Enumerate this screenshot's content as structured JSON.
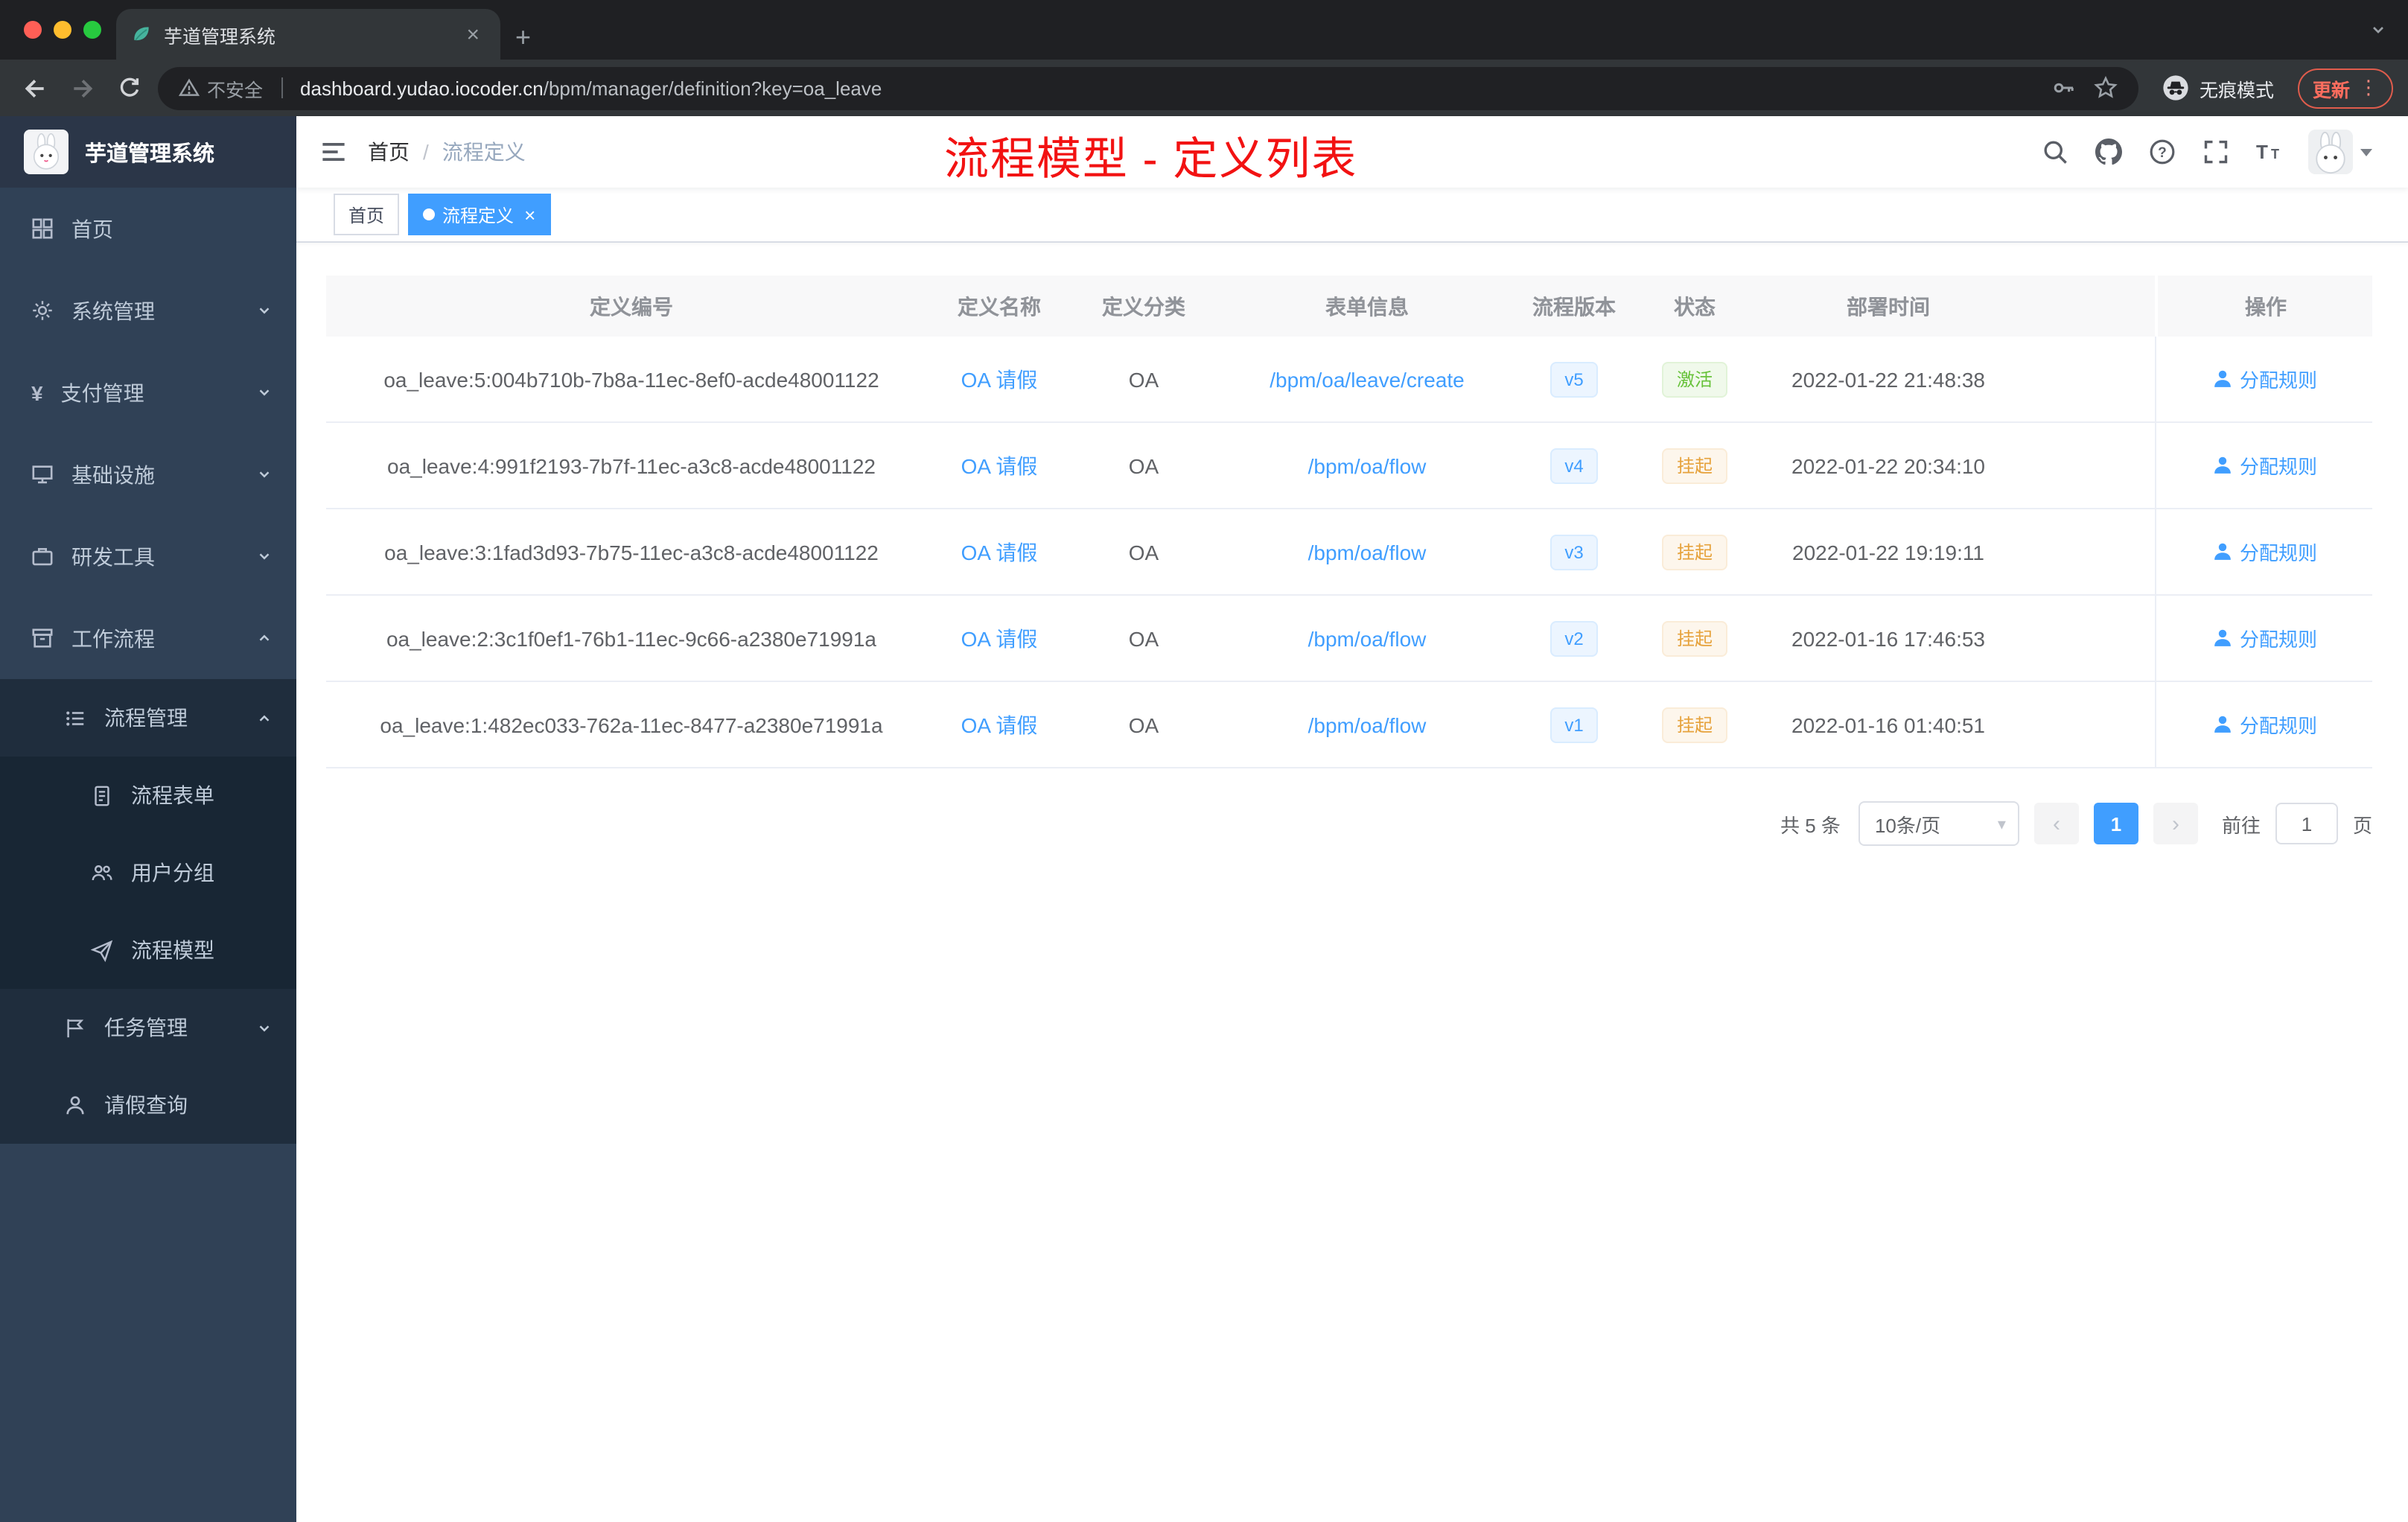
{
  "colors": {
    "accent": "#409eff",
    "annotation_red": "#f21212",
    "sidebar_bg": "#304156",
    "success": "#67c23a",
    "warning": "#e6a23c"
  },
  "icons": {
    "close": "×",
    "plus": "+",
    "more_vertical": "⋮",
    "prev": "‹",
    "next": "›",
    "select_caret": "▾",
    "help": "?"
  },
  "browser": {
    "tab_title": "芋道管理系统",
    "security_label": "不安全",
    "url_host": "dashboard.yudao.iocoder.cn",
    "url_path": "/bpm/manager/definition?key=oa_leave",
    "incognito_label": "无痕模式",
    "update_label": "更新"
  },
  "sidebar": {
    "logo_title": "芋道管理系统",
    "items": [
      {
        "label": "首页"
      },
      {
        "label": "系统管理"
      },
      {
        "label": "支付管理"
      },
      {
        "label": "基础设施"
      },
      {
        "label": "研发工具"
      },
      {
        "label": "工作流程"
      }
    ],
    "workflow": {
      "process_management": {
        "label": "流程管理"
      },
      "process_form": {
        "label": "流程表单"
      },
      "user_group": {
        "label": "用户分组"
      },
      "process_model": {
        "label": "流程模型"
      },
      "task_management": {
        "label": "任务管理"
      },
      "leave_query": {
        "label": "请假查询"
      }
    }
  },
  "header": {
    "breadcrumb_home": "首页",
    "breadcrumb_sep": "/",
    "breadcrumb_current": "流程定义",
    "annotation": "流程模型 - 定义列表"
  },
  "tags_view": {
    "tags": [
      {
        "label": "首页",
        "active": false
      },
      {
        "label": "流程定义",
        "active": true
      }
    ]
  },
  "table": {
    "columns": [
      "定义编号",
      "定义名称",
      "定义分类",
      "表单信息",
      "流程版本",
      "状态",
      "部署时间",
      "操作"
    ],
    "rows": [
      {
        "id": "oa_leave:5:004b710b-7b8a-11ec-8ef0-acde48001122",
        "name": "OA 请假",
        "category": "OA",
        "form": "/bpm/oa/leave/create",
        "version": "v5",
        "status": "激活",
        "status_type": "success",
        "time": "2022-01-22 21:48:38",
        "action": "分配规则"
      },
      {
        "id": "oa_leave:4:991f2193-7b7f-11ec-a3c8-acde48001122",
        "name": "OA 请假",
        "category": "OA",
        "form": "/bpm/oa/flow",
        "version": "v4",
        "status": "挂起",
        "status_type": "warning",
        "time": "2022-01-22 20:34:10",
        "action": "分配规则"
      },
      {
        "id": "oa_leave:3:1fad3d93-7b75-11ec-a3c8-acde48001122",
        "name": "OA 请假",
        "category": "OA",
        "form": "/bpm/oa/flow",
        "version": "v3",
        "status": "挂起",
        "status_type": "warning",
        "time": "2022-01-22 19:19:11",
        "action": "分配规则"
      },
      {
        "id": "oa_leave:2:3c1f0ef1-76b1-11ec-9c66-a2380e71991a",
        "name": "OA 请假",
        "category": "OA",
        "form": "/bpm/oa/flow",
        "version": "v2",
        "status": "挂起",
        "status_type": "warning",
        "time": "2022-01-16 17:46:53",
        "action": "分配规则"
      },
      {
        "id": "oa_leave:1:482ec033-762a-11ec-8477-a2380e71991a",
        "name": "OA 请假",
        "category": "OA",
        "form": "/bpm/oa/flow",
        "version": "v1",
        "status": "挂起",
        "status_type": "warning",
        "time": "2022-01-16 01:40:51",
        "action": "分配规则"
      }
    ]
  },
  "pagination": {
    "total": "共 5 条",
    "page_size": "10条/页",
    "current_page": "1",
    "goto": "前往",
    "goto_value": "1",
    "unit": "页"
  }
}
